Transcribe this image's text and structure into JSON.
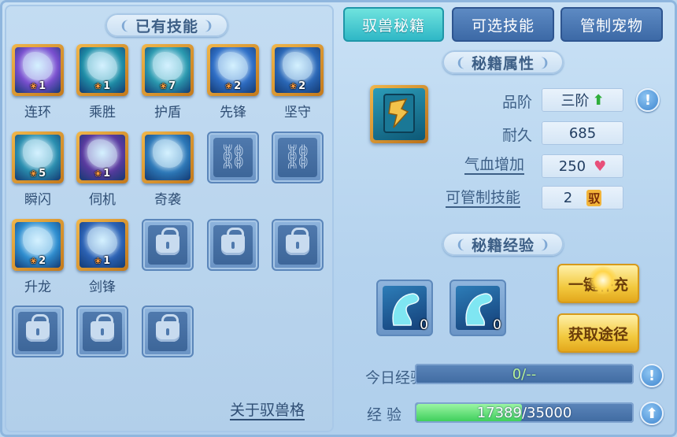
{
  "owned_skills": {
    "title": "已有技能",
    "skills": [
      {
        "name": "连环",
        "level": "1",
        "icon": "claw-icon",
        "color": "#7a4fd0"
      },
      {
        "name": "乘胜",
        "level": "1",
        "icon": "arrow-sweep-icon",
        "color": "#1e8fa8"
      },
      {
        "name": "护盾",
        "level": "7",
        "icon": "shield-icon",
        "color": "#2a9ab0"
      },
      {
        "name": "先锋",
        "level": "2",
        "icon": "crystal-icon",
        "color": "#2f6fc7"
      },
      {
        "name": "坚守",
        "level": "2",
        "icon": "bowl-icon",
        "color": "#2a68b8"
      },
      {
        "name": "瞬闪",
        "level": "5",
        "icon": "beast-icon",
        "color": "#2a8fb0"
      },
      {
        "name": "伺机",
        "level": "1",
        "icon": "wolf-icon",
        "color": "#5a3aa0"
      },
      {
        "name": "奇袭",
        "level": "",
        "icon": "strike-icon",
        "color": "#2c78b8"
      },
      {
        "name": "升龙",
        "level": "2",
        "icon": "dragon-icon",
        "color": "#2e8ed0"
      },
      {
        "name": "剑锋",
        "level": "1",
        "icon": "blade-icon",
        "color": "#2b62b5"
      }
    ],
    "about_link": "关于驭兽格"
  },
  "tabs": [
    {
      "label": "驭兽秘籍",
      "active": true
    },
    {
      "label": "可选技能",
      "active": false
    },
    {
      "label": "管制宠物",
      "active": false
    }
  ],
  "book_props": {
    "title": "秘籍属性",
    "rank_label": "品阶",
    "rank_value": "三阶",
    "durability_label": "耐久",
    "durability_value": "685",
    "hp_label": "气血增加",
    "hp_value": "250",
    "control_label": "可管制技能",
    "control_value": "2",
    "control_badge": "驭"
  },
  "book_exp": {
    "title": "秘籍经验",
    "items": [
      {
        "count": "0",
        "icon": "horse-head-icon"
      },
      {
        "count": "0",
        "icon": "horse-head-icon"
      }
    ],
    "one_click_label": "一键补充",
    "obtain_label": "获取途径",
    "today_label": "今日经验:",
    "today_value": "0/--",
    "exp_label": "经 验",
    "exp_current": 17389,
    "exp_max": 35000,
    "exp_text": "17389/35000"
  },
  "colors": {
    "active_tab": "#3cc3cc",
    "gold_button": "#f2c93e",
    "exp_fill": "#4fd668"
  }
}
